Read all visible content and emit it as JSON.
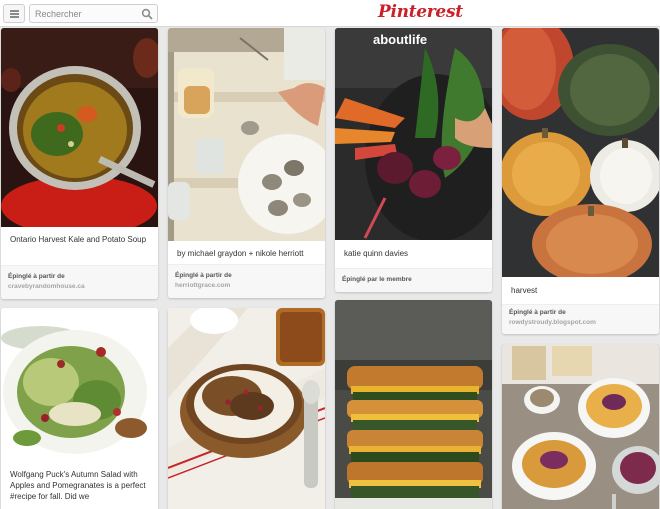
{
  "app": {
    "logo": "Pinterest",
    "brand_color": "#cb2027"
  },
  "search": {
    "placeholder": "Rechercher"
  },
  "pins": [
    {
      "description": "Ontario Harvest Kale and Potato Soup",
      "pinned_from": "Épinglé à partir de",
      "source": "cravebyrandomhouse.ca"
    },
    {
      "description": "by michael graydon + nikole herriott",
      "pinned_from": "Épinglé à partir de",
      "source": "herriottgrace.com"
    },
    {
      "description": "katie quinn davies",
      "pinned_from": "Épinglé par le membre",
      "source": ""
    },
    {
      "description": "harvest",
      "pinned_from": "Épinglé à partir de",
      "source": "rowdystroudy.blogspot.com"
    },
    {
      "description": "Wolfgang Puck's Autumn Salad with Apples and Pomegranates is a perfect #recipe for fall. Did we"
    }
  ]
}
